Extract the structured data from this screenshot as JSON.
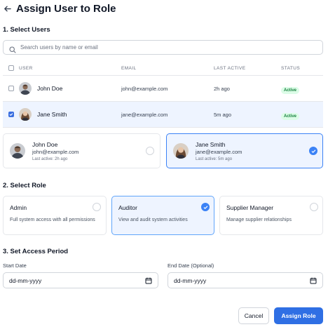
{
  "header": {
    "title": "Assign User to Role",
    "back_icon": "arrow-left-icon"
  },
  "sections": {
    "select_users": "1. Select Users",
    "select_role": "2. Select Role",
    "access_period": "3. Set Access Period"
  },
  "search": {
    "placeholder": "Search users by name or email",
    "value": ""
  },
  "table": {
    "headers": {
      "user": "USER",
      "email": "EMAIL",
      "last_active": "LAST ACTIVE",
      "status": "STATUS"
    },
    "rows": [
      {
        "name": "John Doe",
        "email": "john@example.com",
        "last_active": "2h ago",
        "status": "Active",
        "selected": false
      },
      {
        "name": "Jane Smith",
        "email": "jane@example.com",
        "last_active": "5m ago",
        "status": "Active",
        "selected": true
      }
    ]
  },
  "selected_cards": [
    {
      "name": "John Doe",
      "email": "john@example.com",
      "last_active": "Last active: 2h ago",
      "selected": false
    },
    {
      "name": "Jane Smith",
      "email": "jane@example.com",
      "last_active": "Last active: 5m ago",
      "selected": true
    }
  ],
  "roles": [
    {
      "title": "Admin",
      "description": "Full system access with all permissions",
      "selected": false
    },
    {
      "title": "Auditor",
      "description": "View and audit system activities",
      "selected": true
    },
    {
      "title": "Supplier Manager",
      "description": "Manage supplier relationships",
      "selected": false
    }
  ],
  "access": {
    "start_label": "Start Date",
    "start_value": "dd-mm-yyyy",
    "end_label": "End Date (Optional)",
    "end_value": "dd-mm-yyyy"
  },
  "buttons": {
    "cancel": "Cancel",
    "assign": "Assign Role"
  },
  "colors": {
    "accent": "#2f6fe4",
    "selected_bg": "#eef4ff",
    "badge_bg": "#dcfce7",
    "badge_text": "#15803d"
  }
}
